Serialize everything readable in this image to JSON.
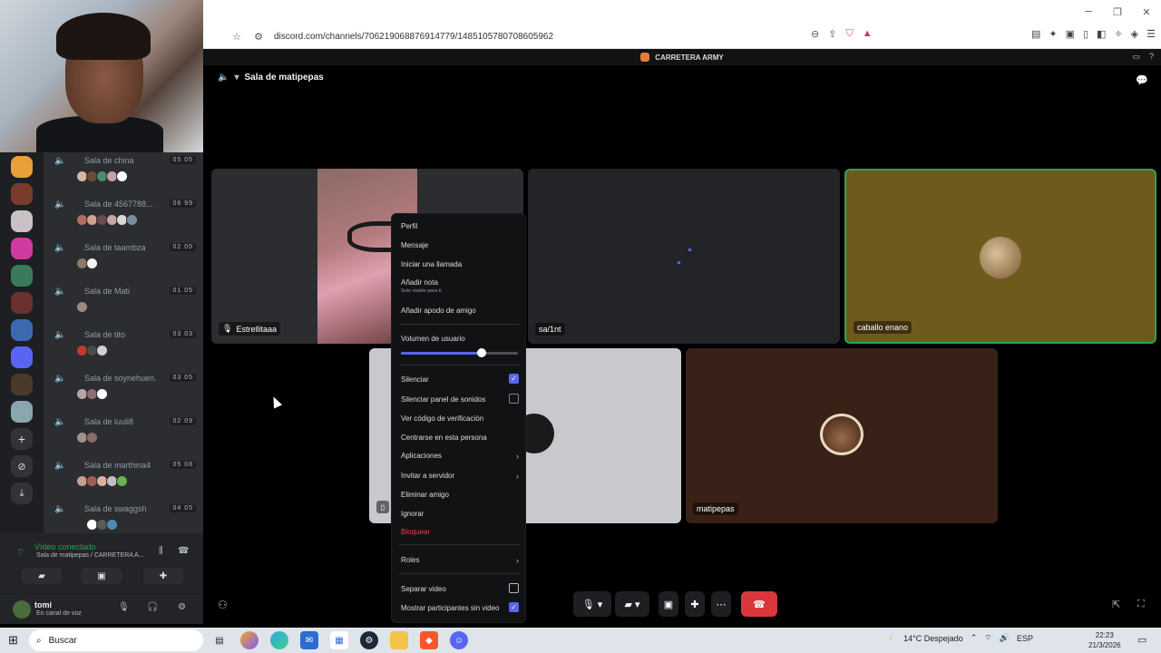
{
  "browser": {
    "url": "discord.com/channels/706219068876914779/1485105780708605962",
    "window_controls": [
      "─",
      "❐",
      "✕"
    ]
  },
  "topbar": {
    "server_name": "CARRETERA ARMY"
  },
  "voice_rooms": [
    {
      "name": "Sala de china",
      "count": "05 05",
      "avatar_colors": [
        "#d9b6a0",
        "#6d4b3a",
        "#4a8c6b",
        "#c5a0b0",
        "#ffffff"
      ]
    },
    {
      "name": "Sala de 4567788...",
      "count": "06 99",
      "avatar_colors": [
        "#b07060",
        "#d1a091",
        "#6a4a4a",
        "#c9a6a6",
        "#d8d8d8",
        "#7c8c9c"
      ]
    },
    {
      "name": "Sala de taambza",
      "count": "02 05",
      "avatar_colors": [
        "#8c7a66",
        "#f2f2f2"
      ]
    },
    {
      "name": "Sala de Mati",
      "count": "01 05",
      "avatar_colors": [
        "#9c8a7a"
      ]
    },
    {
      "name": "Sala de tito",
      "count": "03 03",
      "avatar_colors": [
        "#c0392b",
        "#4a4a4a",
        "#d0d0d0"
      ]
    },
    {
      "name": "Sala de soynehuen.",
      "count": "03 05",
      "avatar_colors": [
        "#b7a6a6",
        "#8c7070",
        "#ffffff"
      ]
    },
    {
      "name": "Sala de luuli8",
      "count": "02 09",
      "avatar_colors": [
        "#a09090",
        "#8c6c6c"
      ]
    },
    {
      "name": "Sala de marthina4",
      "count": "05 08",
      "avatar_colors": [
        "#c4a090",
        "#a06050",
        "#e0b0a0",
        "#c0c0c0",
        "#6ab04c"
      ]
    },
    {
      "name": "Sala de swaggsh",
      "count": "04 05",
      "avatar_colors": [
        "#2b2b2b",
        "#ffffff",
        "#5a5a5a",
        "#4a8cb0"
      ]
    }
  ],
  "voice_panel": {
    "status": "Vídeo conectado",
    "location": "Sala de matipepas / CARRETERA A...",
    "user": {
      "name": "tomi",
      "status": "En canal de voz"
    }
  },
  "stage": {
    "channel_title": "Sala de matipepas",
    "tiles": [
      {
        "name": "Estrellitaaa"
      },
      {
        "name": "sa/1nt"
      },
      {
        "name": "caballo enano"
      },
      {
        "name": "matipepas"
      }
    ]
  },
  "context_menu": {
    "items": [
      {
        "label": "Perfil"
      },
      {
        "label": "Mensaje"
      },
      {
        "label": "Iniciar una llamada"
      },
      {
        "label": "Añadir nota",
        "sub": "Solo visible para ti"
      },
      {
        "label": "Añadir apodo de amigo"
      },
      {
        "label": "Volumen de usuario"
      },
      {
        "label": "Silenciar",
        "checked": true
      },
      {
        "label": "Silenciar panel de sonidos",
        "checked": false
      },
      {
        "label": "Ver código de verificación"
      },
      {
        "label": "Centrarse en esta persona"
      },
      {
        "label": "Aplicaciones"
      },
      {
        "label": "Invitar a servidor"
      },
      {
        "label": "Eliminar amigo"
      },
      {
        "label": "Ignorar"
      },
      {
        "label": "Bloquear",
        "danger": true
      },
      {
        "label": "Roles"
      },
      {
        "label": "Separar video"
      },
      {
        "label": "Mostrar participantes sin video",
        "checked": true
      }
    ],
    "user_volume_fraction": 0.69
  },
  "taskbar": {
    "search_placeholder": "Buscar",
    "weather": "14°C Despejado",
    "language": "ESP",
    "time": "22:23",
    "date": "21/3/2026"
  },
  "colors": {
    "accent": "#5865f2",
    "voice_green": "#23a55a",
    "danger": "#da373c",
    "speaking_border": "#23a55a"
  }
}
